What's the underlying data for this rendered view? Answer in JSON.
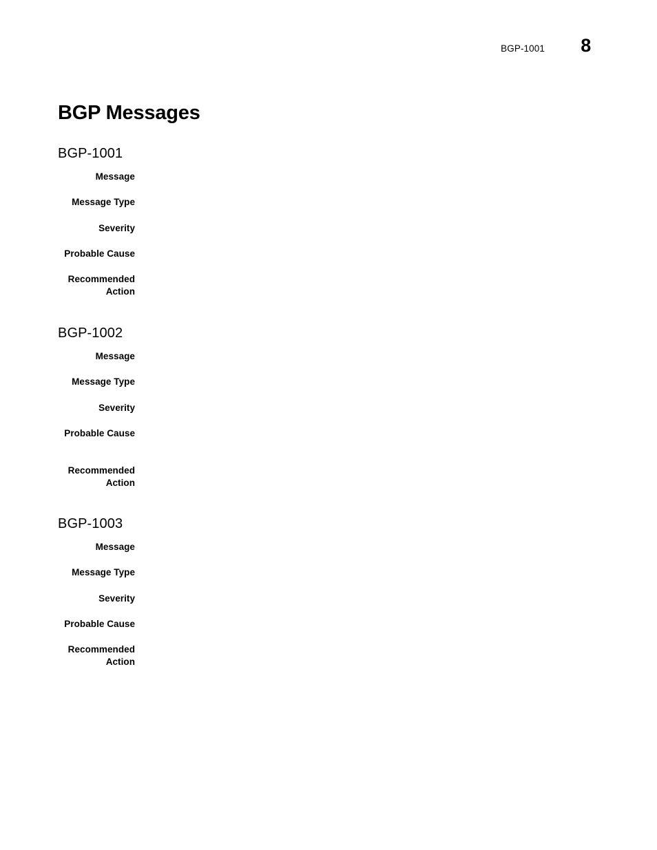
{
  "header": {
    "chapter_label": "BGP-1001",
    "page_number": "8"
  },
  "document": {
    "title": "BGP Messages"
  },
  "labels": {
    "message": "Message",
    "message_type": "Message Type",
    "severity": "Severity",
    "probable_cause": "Probable Cause",
    "recommended_action_line1": "Recommended",
    "recommended_action_line2": "Action"
  },
  "sections": [
    {
      "heading": "BGP-1001",
      "fields": {
        "message": "",
        "message_type": "",
        "severity": "",
        "probable_cause": "",
        "recommended_action": ""
      }
    },
    {
      "heading": "BGP-1002",
      "fields": {
        "message": "",
        "message_type": "",
        "severity": "",
        "probable_cause": "",
        "recommended_action": ""
      }
    },
    {
      "heading": "BGP-1003",
      "fields": {
        "message": "",
        "message_type": "",
        "severity": "",
        "probable_cause": "",
        "recommended_action": ""
      }
    }
  ],
  "layout": {
    "section_tops": [
      196,
      457,
      734
    ],
    "row_tops": [
      [
        52,
        89,
        127,
        164,
        201,
        219
      ],
      [
        52,
        89,
        127,
        164,
        218,
        236
      ],
      [
        52,
        89,
        127,
        164,
        201,
        219
      ]
    ]
  }
}
